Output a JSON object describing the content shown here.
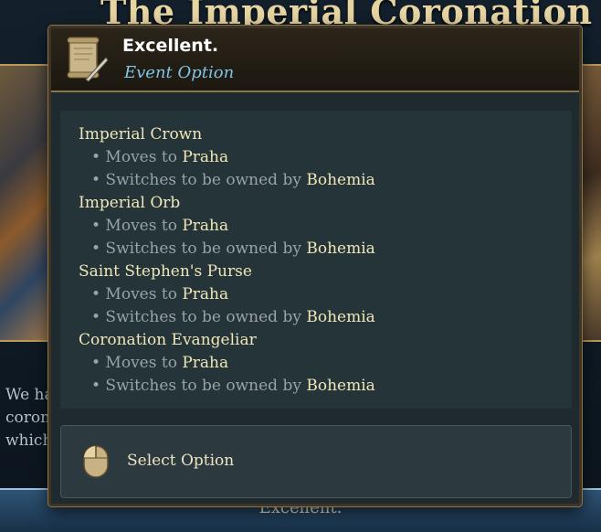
{
  "background": {
    "event_title": "The Imperial Coronation",
    "description_lines": [
      "We ha",
      "coron",
      "which"
    ],
    "option_button_label": "Excellent."
  },
  "popup": {
    "title": "Excellent.",
    "subtitle": "Event Option",
    "effects": [
      {
        "name": "Imperial Crown",
        "lines": [
          {
            "prefix": "• Moves to ",
            "value": "Praha"
          },
          {
            "prefix": "• Switches to be owned by ",
            "value": "Bohemia"
          }
        ]
      },
      {
        "name": "Imperial Orb",
        "lines": [
          {
            "prefix": "• Moves to ",
            "value": "Praha"
          },
          {
            "prefix": "• Switches to be owned by ",
            "value": "Bohemia"
          }
        ]
      },
      {
        "name": "Saint Stephen's Purse",
        "lines": [
          {
            "prefix": "• Moves to ",
            "value": "Praha"
          },
          {
            "prefix": "• Switches to be owned by ",
            "value": "Bohemia"
          }
        ]
      },
      {
        "name": "Coronation Evangeliar",
        "lines": [
          {
            "prefix": "• Moves to ",
            "value": "Praha"
          },
          {
            "prefix": "• Switches to be owned by ",
            "value": "Bohemia"
          }
        ]
      }
    ],
    "select_label": "Select Option"
  },
  "icons": {
    "header": "scroll-quill-icon",
    "select": "mouse-left-click-icon"
  },
  "colors": {
    "highlight": "#f1e6b8",
    "subtitle": "#7ec4e6",
    "muted": "#9aa3a6",
    "frame_gold": "#8c7647"
  }
}
